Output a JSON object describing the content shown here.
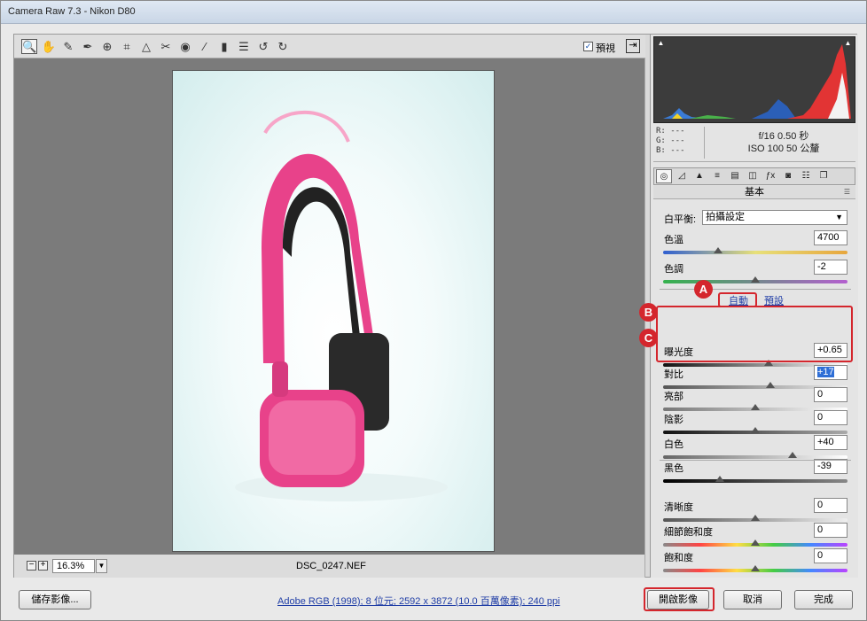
{
  "window": {
    "title": "Camera Raw 7.3  -  Nikon D80"
  },
  "toolbar": {
    "tools": [
      {
        "name": "zoom-tool-icon",
        "glyph": "🔍"
      },
      {
        "name": "hand-tool-icon",
        "glyph": "✋"
      },
      {
        "name": "white-balance-tool-icon",
        "glyph": "✎"
      },
      {
        "name": "color-sampler-tool-icon",
        "glyph": "✒"
      },
      {
        "name": "targeted-adjustment-tool-icon",
        "glyph": "⊕"
      },
      {
        "name": "crop-tool-icon",
        "glyph": "⌗"
      },
      {
        "name": "straighten-tool-icon",
        "glyph": "△"
      },
      {
        "name": "spot-removal-tool-icon",
        "glyph": "✂"
      },
      {
        "name": "red-eye-tool-icon",
        "glyph": "◉"
      },
      {
        "name": "adjustment-brush-icon",
        "glyph": "∕"
      },
      {
        "name": "graduated-filter-icon",
        "glyph": "▮"
      },
      {
        "name": "preferences-icon",
        "glyph": "☰"
      },
      {
        "name": "rotate-left-icon",
        "glyph": "↺"
      },
      {
        "name": "rotate-right-icon",
        "glyph": "↻"
      }
    ],
    "preview_label": "預視",
    "preview_checked": "✓"
  },
  "statusbar": {
    "zoom": "16.3%",
    "filename": "DSC_0247.NEF"
  },
  "histogram": {
    "r": "R:  ---",
    "g": "G:  ---",
    "b": "B:  ---",
    "camera_line1": "f/16   0.50 秒",
    "camera_line2": "ISO 100   50 公釐"
  },
  "panel": {
    "title": "基本",
    "white_balance_label": "白平衡:",
    "white_balance_value": "拍攝設定",
    "auto_link": "自動",
    "default_link": "預設",
    "controls": [
      {
        "label": "色溫",
        "value": "4700",
        "position": 0.3
      },
      {
        "label": "色調",
        "value": "-2",
        "position": 0.5
      },
      {
        "label": "曝光度",
        "value": "+0.65",
        "position": 0.57
      },
      {
        "label": "對比",
        "value": "+17",
        "position": 0.58
      },
      {
        "label": "亮部",
        "value": "0",
        "position": 0.5
      },
      {
        "label": "陰影",
        "value": "0",
        "position": 0.5
      },
      {
        "label": "白色",
        "value": "+40",
        "position": 0.7
      },
      {
        "label": "黑色",
        "value": "-39",
        "position": 0.31
      },
      {
        "label": "清晰度",
        "value": "0",
        "position": 0.5
      },
      {
        "label": "細節飽和度",
        "value": "0",
        "position": 0.5
      },
      {
        "label": "飽和度",
        "value": "0",
        "position": 0.5
      }
    ]
  },
  "markers": {
    "a": "A",
    "b": "B",
    "c": "C"
  },
  "bottom": {
    "save_label": "儲存影像...",
    "info_link": "Adobe RGB (1998); 8 位元; 2592 x 3872 (10.0 百萬像素); 240 ppi",
    "open_label": "開啟影像",
    "cancel_label": "取消",
    "done_label": "完成"
  },
  "colors": {
    "accent_red": "#d4262d",
    "link_blue": "#1f3da6",
    "selection_blue": "#2f6fd6",
    "headphone_pink": "#e8428a"
  }
}
